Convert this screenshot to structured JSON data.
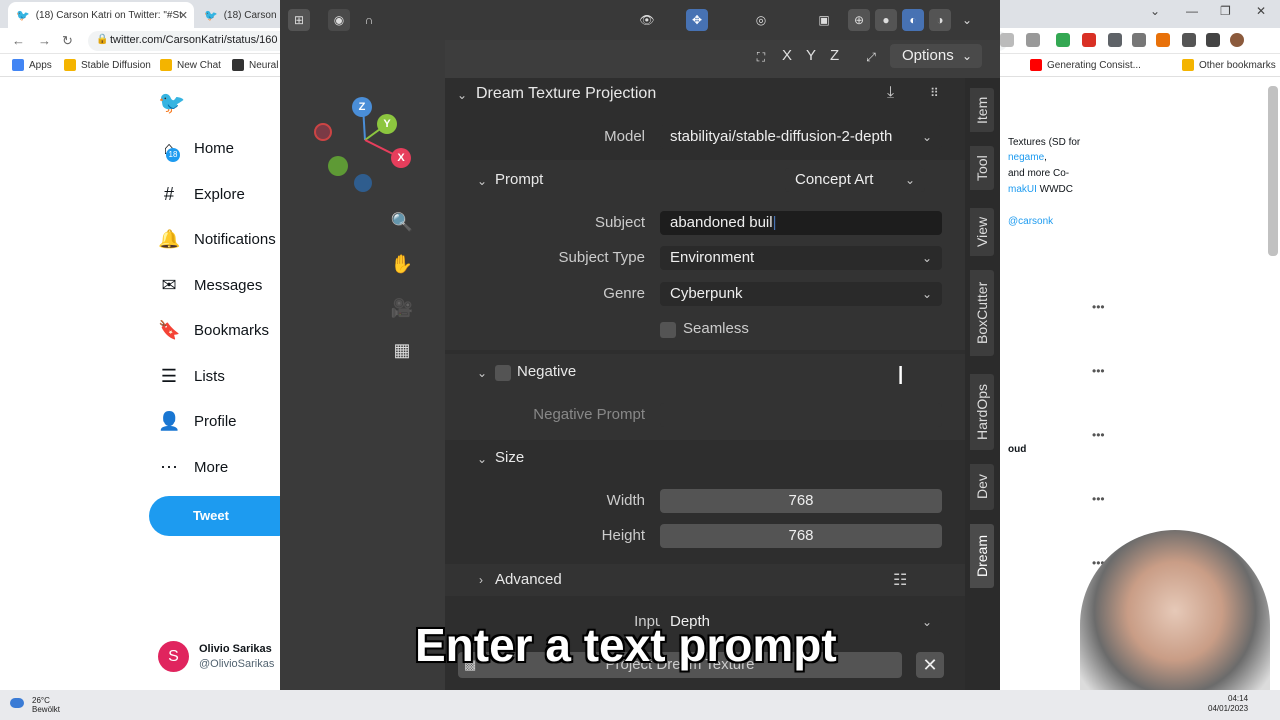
{
  "browser": {
    "tabs": [
      {
        "label": "(18) Carson Katri on Twitter: \"#St",
        "active": true
      },
      {
        "label": "(18) Carson Ka",
        "active": false
      }
    ],
    "url": "twitter.com/CarsonKatri/status/160",
    "bookmarks": [
      "Apps",
      "Stable Diffusion",
      "New Chat",
      "Neural"
    ],
    "bookmarks_right": [
      "Generating Consist...",
      "Other bookmarks"
    ]
  },
  "twitter": {
    "nav": [
      "Home",
      "Explore",
      "Notifications",
      "Messages",
      "Bookmarks",
      "Lists",
      "Profile",
      "More"
    ],
    "notification_count": "18",
    "tweet_button": "Tweet",
    "user": {
      "avatar_letter": "S",
      "name": "Olivio Sarikas",
      "handle": "@OlivioSarikas"
    },
    "right_snippets": {
      "line1": "Textures (SD for",
      "line2_link": "negame",
      "line2_suffix": ",",
      "line3": "and more Co-",
      "line4_link": "makUI",
      "line4_suffix": " WWDC",
      "line5_link": "@carsonk",
      "line6": "oud"
    }
  },
  "blender": {
    "header": {
      "axes": [
        "X",
        "Y",
        "Z"
      ],
      "options_label": "Options"
    },
    "gizmo": {
      "z": "Z",
      "y": "Y",
      "x": "X"
    },
    "panel": {
      "title": "Dream Texture Projection",
      "model_label": "Model",
      "model_value": "stabilityai/stable-diffusion-2-depth",
      "prompt_section": "Prompt",
      "prompt_preset": "Concept Art",
      "subject_label": "Subject",
      "subject_value": "abandoned buil",
      "subject_type_label": "Subject Type",
      "subject_type_value": "Environment",
      "genre_label": "Genre",
      "genre_value": "Cyberpunk",
      "seamless_label": "Seamless",
      "negative_section": "Negative",
      "negative_prompt_label": "Negative Prompt",
      "size_section": "Size",
      "width_label": "Width",
      "width_value": "768",
      "height_label": "Height",
      "height_value": "768",
      "advanced_section": "Advanced",
      "inputs_label": "Inputs",
      "inputs_value": "Depth",
      "project_button": "Project Dream Texture"
    },
    "side_tabs": [
      "Item",
      "Tool",
      "View",
      "BoxCutter",
      "HardOps",
      "Dev",
      "Dream"
    ],
    "active_side_tab": "Dream",
    "caption": "Enter a text prompt"
  },
  "taskbar": {
    "weather_temp": "26°C",
    "weather_desc": "Bewölkt",
    "time": "04:14",
    "date": "04/01/2023"
  },
  "colors": {
    "twitter_blue": "#1d9bf0",
    "blender_bg": "#3d3d3d",
    "blender_active": "#4772b3"
  }
}
